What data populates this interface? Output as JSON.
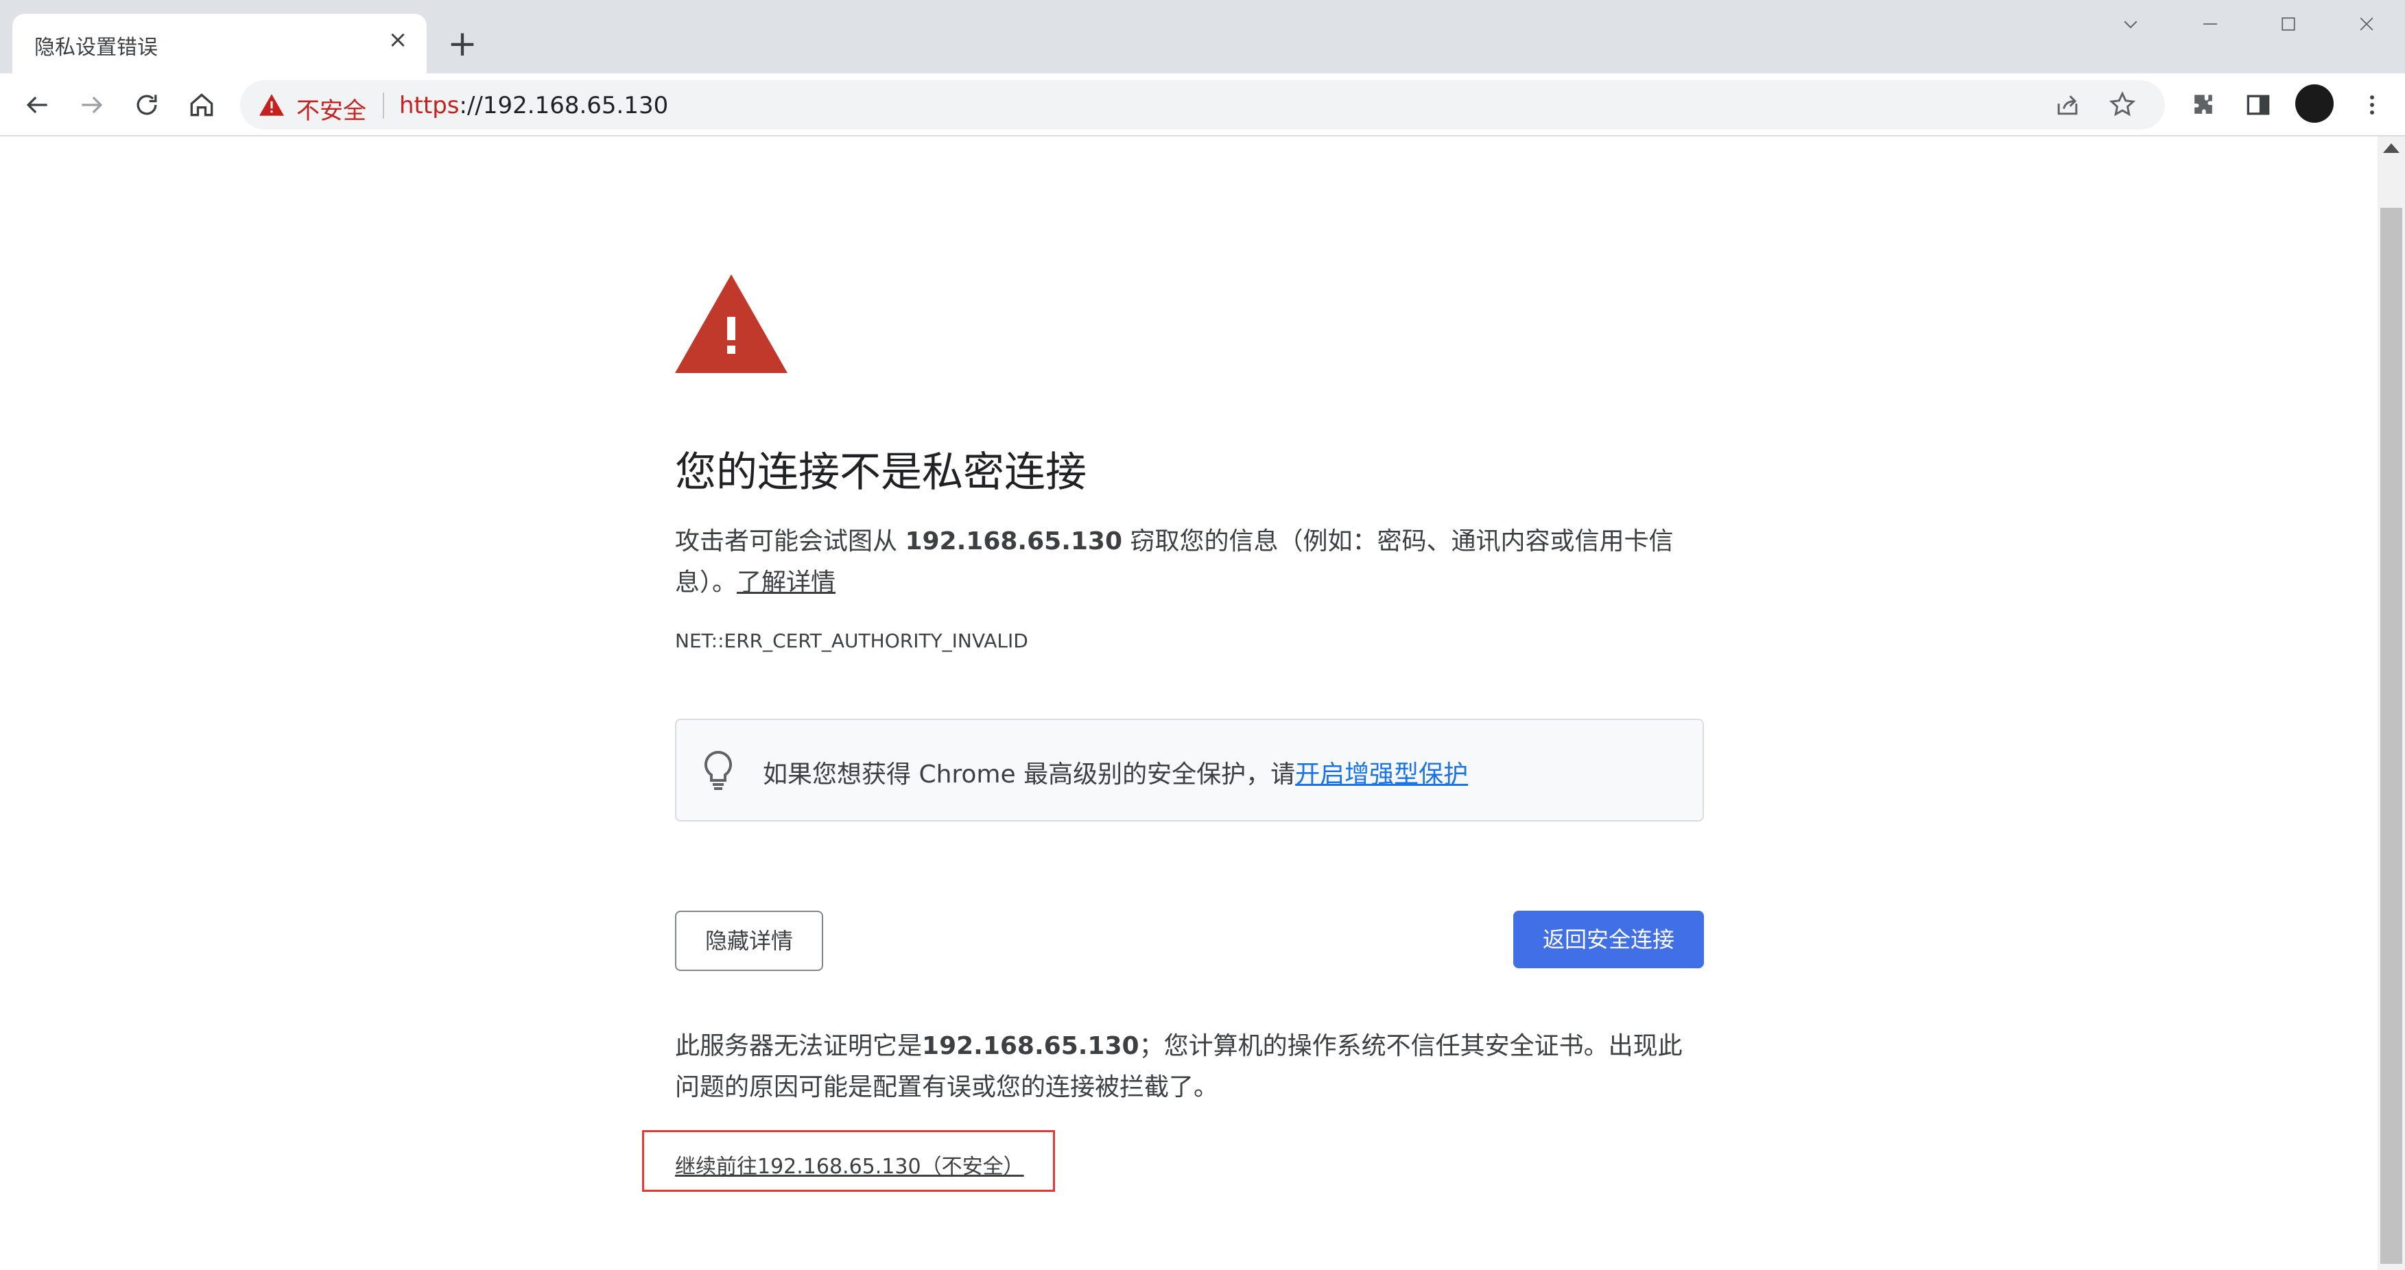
{
  "tab": {
    "title": "隐私设置错误",
    "close": "×",
    "new_tab": "+"
  },
  "window_controls": {
    "dropdown": "⌵",
    "minimize": "—",
    "maximize": "☐",
    "close": "✕"
  },
  "omnibox": {
    "security_label": "不安全",
    "url_scheme": "https",
    "url_rest": "://192.168.65.130"
  },
  "page": {
    "heading": "您的连接不是私密连接",
    "desc_prefix": "攻击者可能会试图从 ",
    "desc_host": "192.168.65.130",
    "desc_suffix": " 窃取您的信息（例如：密码、通讯内容或信用卡信息）。",
    "learn_more": "了解详情",
    "error_code": "NET::ERR_CERT_AUTHORITY_INVALID",
    "tip_text": "如果您想获得 Chrome 最高级别的安全保护，请",
    "tip_link": "开启增强型保护",
    "hide_details_button": "隐藏详情",
    "back_button": "返回安全连接",
    "detail_prefix": "此服务器无法证明它是",
    "detail_host": "192.168.65.130",
    "detail_suffix": "；您计算机的操作系统不信任其安全证书。出现此问题的原因可能是配置有误或您的连接被拦截了。",
    "proceed_link": "继续前往192.168.65.130（不安全）"
  },
  "colors": {
    "danger": "#c5221f",
    "primary_button": "#4170e6",
    "link": "#1a73e8",
    "highlight_box": "#e53935"
  }
}
